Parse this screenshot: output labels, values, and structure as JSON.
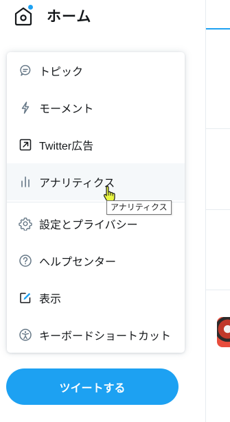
{
  "header": {
    "title": "ホーム",
    "icon": "home-icon",
    "notification_dot_color": "#1da1f2"
  },
  "menu": {
    "items": [
      {
        "label": "トピック",
        "icon": "topic-icon"
      },
      {
        "label": "モーメント",
        "icon": "lightning-icon"
      },
      {
        "label": "Twitter広告",
        "icon": "external-arrow-icon"
      },
      {
        "label": "アナリティクス",
        "icon": "bar-chart-icon",
        "hovered": true
      },
      {
        "label": "設定とプライバシー",
        "icon": "gear-icon"
      },
      {
        "label": "ヘルプセンター",
        "icon": "question-icon"
      },
      {
        "label": "表示",
        "icon": "display-pen-icon"
      },
      {
        "label": "キーボードショートカット",
        "icon": "accessibility-icon"
      }
    ]
  },
  "tooltip": {
    "text": "アナリティクス"
  },
  "tweet_button": {
    "label": "ツイートする"
  },
  "colors": {
    "accent": "#1da1f2",
    "text": "#14171a",
    "divider": "#e6ecf0",
    "hover_bg": "#f5f8fa"
  }
}
